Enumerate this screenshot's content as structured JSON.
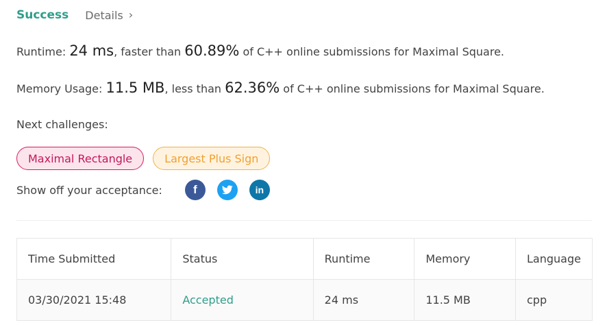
{
  "header": {
    "status": "Success",
    "details_label": "Details",
    "chevron": "›"
  },
  "runtime": {
    "label": "Runtime: ",
    "value": "24 ms",
    "mid": ", faster than ",
    "percent": "60.89%",
    "suffix": " of C++ online submissions for Maximal Square."
  },
  "memory": {
    "label": "Memory Usage: ",
    "value": "11.5 MB",
    "mid": ", less than ",
    "percent": "62.36%",
    "suffix": " of C++ online submissions for Maximal Square."
  },
  "next_challenges": {
    "label": "Next challenges:",
    "items": [
      {
        "label": "Maximal Rectangle",
        "color": "#c2185b"
      },
      {
        "label": "Largest Plus Sign",
        "color": "#f0a030"
      }
    ]
  },
  "share": {
    "label": "Show off your acceptance:",
    "facebook": "f",
    "twitter": "twitter-icon",
    "linkedin": "in"
  },
  "table": {
    "headers": [
      "Time Submitted",
      "Status",
      "Runtime",
      "Memory",
      "Language"
    ],
    "rows": [
      [
        "03/30/2021 15:48",
        "Accepted",
        "24 ms",
        "11.5 MB",
        "cpp"
      ]
    ]
  },
  "colors": {
    "accent": "#2f9e8b",
    "facebook": "#3b5998",
    "twitter": "#1da1f2",
    "linkedin": "#0e76a8"
  }
}
